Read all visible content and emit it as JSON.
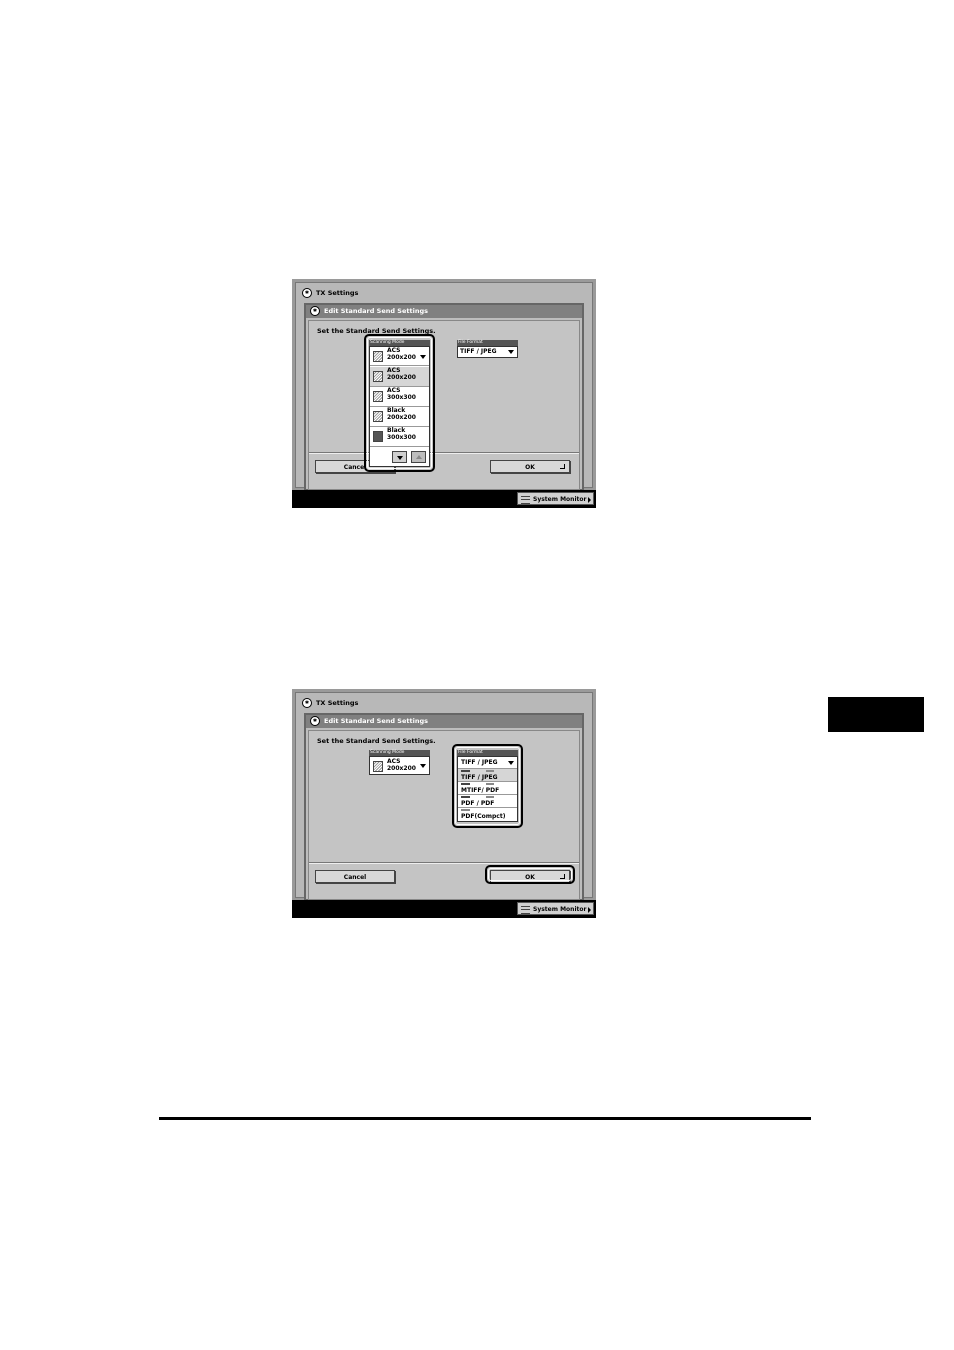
{
  "screens": [
    {
      "window_title": "TX Settings",
      "dialog_title": "Edit Standard Send Settings",
      "instruction": "Set the Standard Send Settings.",
      "scanning_mode": {
        "label": "Scanning Mode",
        "selected_line1": "ACS",
        "selected_line2": "200x200",
        "options": [
          {
            "line1": "ACS",
            "line2": "200x200"
          },
          {
            "line1": "ACS",
            "line2": "300x300"
          },
          {
            "line1": "Black",
            "line2": "200x200"
          },
          {
            "line1": "Black",
            "line2": "300x300"
          }
        ]
      },
      "file_format": {
        "label": "File Format",
        "selected": "TIFF / JPEG"
      },
      "cancel_label": "Cancel",
      "ok_label": "OK",
      "system_monitor_label": "System Monitor"
    },
    {
      "window_title": "TX Settings",
      "dialog_title": "Edit Standard Send Settings",
      "instruction": "Set the Standard Send Settings.",
      "scanning_mode": {
        "label": "Scanning Mode",
        "selected_line1": "ACS",
        "selected_line2": "200x200"
      },
      "file_format": {
        "label": "File Format",
        "selected": "TIFF / JPEG",
        "options": [
          "TIFF / JPEG",
          "MTIFF/ PDF",
          "PDF / PDF",
          "PDF(Compct)"
        ]
      },
      "cancel_label": "Cancel",
      "ok_label": "OK",
      "system_monitor_label": "System Monitor"
    }
  ]
}
